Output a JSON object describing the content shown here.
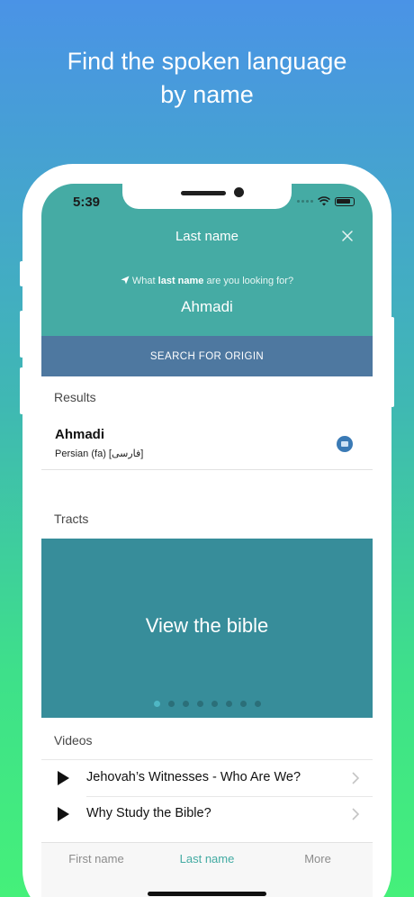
{
  "promo": {
    "line1": "Find the spoken language",
    "line2": "by name"
  },
  "status_bar": {
    "time": "5:39",
    "icons": [
      "signal-icon",
      "wifi-icon",
      "battery-icon"
    ]
  },
  "header": {
    "title": "Last name",
    "close_icon": "close-icon",
    "prompt_prefix": "What ",
    "prompt_bold": "last name",
    "prompt_suffix": " are you looking for?",
    "search_value": "Ahmadi",
    "search_button": "SEARCH FOR ORIGIN",
    "color_header": "#45aba4",
    "color_button": "#4e78a0"
  },
  "results": {
    "label": "Results",
    "items": [
      {
        "name": "Ahmadi",
        "language": "Persian (fa) [فارسی]",
        "icon": "book-icon"
      }
    ]
  },
  "tracts": {
    "label": "Tracts",
    "banner_text": "View the bible",
    "pages_total": 8,
    "current_page": 1,
    "banner_color": "#378d9a"
  },
  "videos": {
    "label": "Videos",
    "items": [
      {
        "title": "Jehovah’s Witnesses - Who Are We?"
      },
      {
        "title": "Why Study the Bible?"
      }
    ]
  },
  "tab_bar": {
    "tabs": [
      {
        "label": "First name",
        "active": false
      },
      {
        "label": "Last name",
        "active": true
      },
      {
        "label": "More",
        "active": false
      }
    ],
    "accent_color": "#43aba3"
  }
}
